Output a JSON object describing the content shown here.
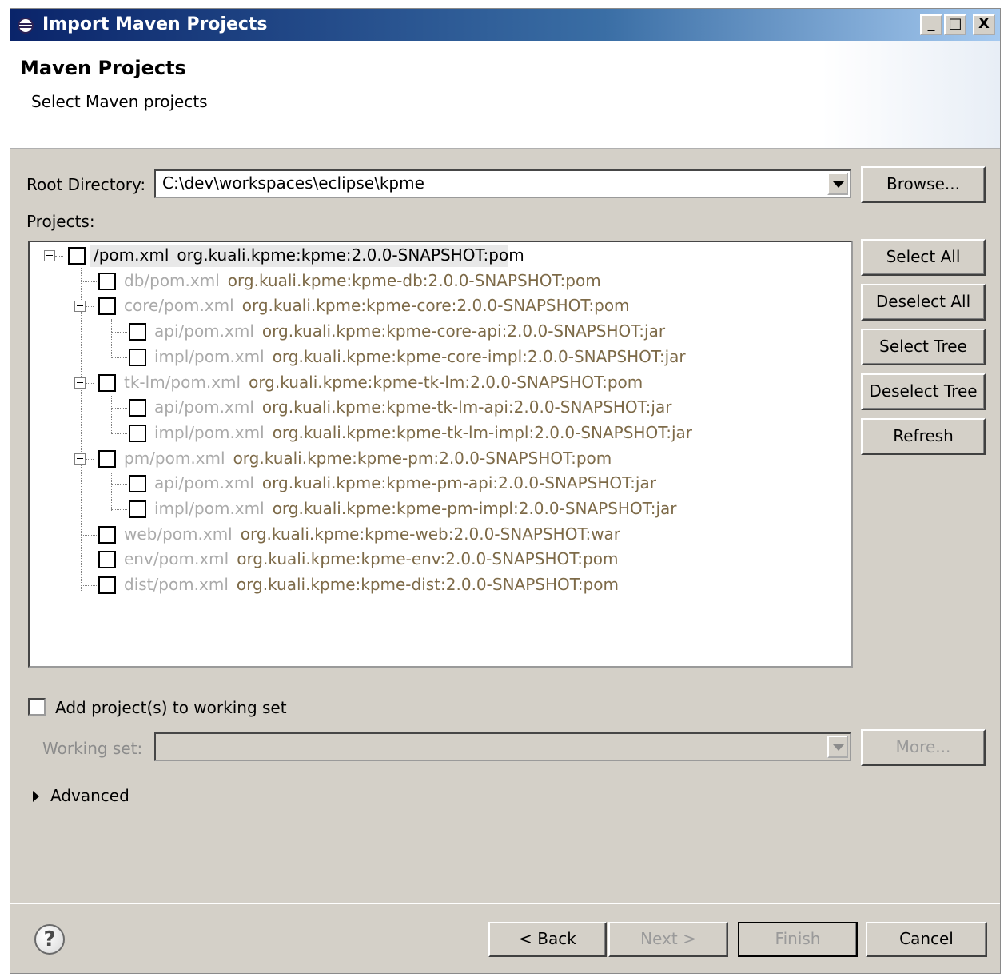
{
  "window": {
    "title": "Import Maven Projects",
    "controls": {
      "minimize": "_",
      "maximize": "□",
      "close": "X"
    }
  },
  "header": {
    "title": "Maven Projects",
    "subtitle": "Select Maven projects"
  },
  "root_directory": {
    "label": "Root Directory:",
    "value": "C:\\dev\\workspaces\\eclipse\\kpme",
    "browse_label": "Browse..."
  },
  "projects": {
    "label": "Projects:",
    "items": [
      {
        "path": "/pom.xml",
        "coord": "org.kuali.kpme:kpme:2.0.0-SNAPSHOT:pom",
        "checked": false
      },
      {
        "path": "db/pom.xml",
        "coord": "org.kuali.kpme:kpme-db:2.0.0-SNAPSHOT:pom",
        "checked": false
      },
      {
        "path": "core/pom.xml",
        "coord": "org.kuali.kpme:kpme-core:2.0.0-SNAPSHOT:pom",
        "checked": false
      },
      {
        "path": "api/pom.xml",
        "coord": "org.kuali.kpme:kpme-core-api:2.0.0-SNAPSHOT:jar",
        "checked": false
      },
      {
        "path": "impl/pom.xml",
        "coord": "org.kuali.kpme:kpme-core-impl:2.0.0-SNAPSHOT:jar",
        "checked": false
      },
      {
        "path": "tk-lm/pom.xml",
        "coord": "org.kuali.kpme:kpme-tk-lm:2.0.0-SNAPSHOT:pom",
        "checked": false
      },
      {
        "path": "api/pom.xml",
        "coord": "org.kuali.kpme:kpme-tk-lm-api:2.0.0-SNAPSHOT:jar",
        "checked": false
      },
      {
        "path": "impl/pom.xml",
        "coord": "org.kuali.kpme:kpme-tk-lm-impl:2.0.0-SNAPSHOT:jar",
        "checked": false
      },
      {
        "path": "pm/pom.xml",
        "coord": "org.kuali.kpme:kpme-pm:2.0.0-SNAPSHOT:pom",
        "checked": false
      },
      {
        "path": "api/pom.xml",
        "coord": "org.kuali.kpme:kpme-pm-api:2.0.0-SNAPSHOT:jar",
        "checked": false
      },
      {
        "path": "impl/pom.xml",
        "coord": "org.kuali.kpme:kpme-pm-impl:2.0.0-SNAPSHOT:jar",
        "checked": false
      },
      {
        "path": "web/pom.xml",
        "coord": "org.kuali.kpme:kpme-web:2.0.0-SNAPSHOT:war",
        "checked": false
      },
      {
        "path": "env/pom.xml",
        "coord": "org.kuali.kpme:kpme-env:2.0.0-SNAPSHOT:pom",
        "checked": false
      },
      {
        "path": "dist/pom.xml",
        "coord": "org.kuali.kpme:kpme-dist:2.0.0-SNAPSHOT:pom",
        "checked": false
      }
    ],
    "buttons": {
      "select_all": "Select All",
      "deselect_all": "Deselect All",
      "select_tree": "Select Tree",
      "deselect_tree": "Deselect Tree",
      "refresh": "Refresh"
    }
  },
  "working_set": {
    "add_label": "Add project(s) to working set",
    "checked": false,
    "label": "Working set:",
    "value": "",
    "more_label": "More..."
  },
  "advanced": {
    "label": "Advanced"
  },
  "footer": {
    "help_icon": "?",
    "back_label": "< Back",
    "next_label": "Next >",
    "finish_label": "Finish",
    "cancel_label": "Cancel"
  },
  "colors": {
    "title_bar": "#0a246a",
    "dialog_bg": "#d4d0c8",
    "path_text": "#aaaaaa",
    "coord_text": "#7d6a48"
  }
}
